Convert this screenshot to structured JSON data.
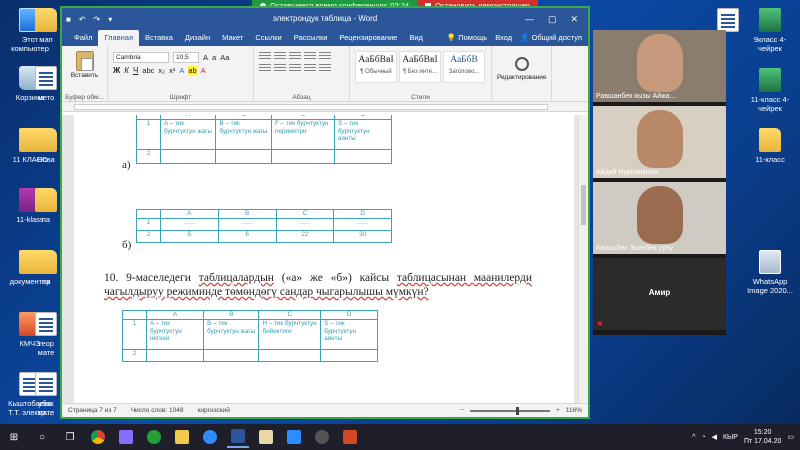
{
  "conference": {
    "time_label": "Оставшееся время конференции: 02:24",
    "stop_label": "Остановить демонстрацию"
  },
  "desktop": {
    "left_icons": [
      "Этот компьютер",
      "Корзина",
      "11 КЛАСС",
      "11-klass",
      "документер",
      "КМЧЭ",
      "Кыштобаева Т.Т. электр..."
    ],
    "left_icons2": [
      "мап",
      "мето",
      "Нова",
      "па",
      "па",
      "теор мате",
      "убак мате"
    ],
    "right_icons": [
      "9класс 4-чейрек",
      "11-класс 4-чейрек",
      "11-класс",
      "WhatsApp Image 2020..."
    ]
  },
  "word": {
    "title": "электрондук таблица - Word",
    "tabs": [
      "Файл",
      "Главная",
      "Вставка",
      "Дизайн",
      "Макет",
      "Ссылки",
      "Рассылки",
      "Рецензирование",
      "Вид"
    ],
    "help": "Помощь",
    "signin": "Вход",
    "share": "Общий доступ",
    "ribbon": {
      "paste": "Вставить",
      "clipboard": "Буфер обм...",
      "font_name": "Cambria",
      "font_size": "10,5",
      "font_group": "Шрифт",
      "para_group": "Абзац",
      "styles_group": "Стили",
      "edit": "Редактирование",
      "styles": [
        {
          "sample": "АаБбВвІ",
          "name": "¶ Обычный"
        },
        {
          "sample": "АаБбВвІ",
          "name": "¶ Без инте..."
        },
        {
          "sample": "АаБбВ",
          "name": "Заголово..."
        }
      ]
    },
    "status": {
      "page": "Страница 7 из 7",
      "words": "Число слов: 1048",
      "lang": "киргизский",
      "zoom": "116%"
    },
    "doc": {
      "table_a": {
        "letter": "а)",
        "headers": [
          "A",
          "B",
          "C",
          "D"
        ],
        "rows": [
          {
            "num": "1",
            "cells": [
              "A – тик бурчтуктун жагы",
              "B – тик бурчтуктун жагы",
              "F – тик бурчтуктун периметри",
              "S – тик бурчтуктун аянты"
            ]
          },
          {
            "num": "2",
            "cells": [
              "",
              "",
              "",
              ""
            ]
          }
        ]
      },
      "table_b": {
        "letter": "б)",
        "headers": [
          "A",
          "B",
          "C",
          "D"
        ],
        "rows": [
          {
            "num": "1",
            "cells": [
              "......",
              "......",
              "......",
              "......"
            ]
          },
          {
            "num": "2",
            "cells": [
              "5",
              "6",
              "22",
              "30"
            ]
          }
        ]
      },
      "task": {
        "number": "10.",
        "text_1": "9-маселедеги",
        "text_2": "таблицалардын",
        "text_3": "(«а» же «б») кайсы",
        "text_4": "таблицасынан маанилерди чагылдыруу режиминде төмөндөгү сандар чыгарылышы мүмкүн?"
      },
      "table_c": {
        "headers": [
          "A",
          "B",
          "C",
          "D"
        ],
        "rows": [
          {
            "num": "1",
            "cells": [
              "A – тик бурчтуктун негизи",
              "B – тик бурчтуктун жагы",
              "H – тик бурчтуктун бийиктиги",
              "S – тик бурчтуктун аянты"
            ]
          },
          {
            "num": "2",
            "cells": [
              "",
              "",
              "",
              ""
            ]
          }
        ]
      }
    }
  },
  "participants": [
    {
      "name": "Равшанбек кызы Айжа...",
      "skin": "#c79a7c",
      "bg": "#8b7d6e"
    },
    {
      "name": "Айдай Нурланкызы",
      "skin": "#b98869",
      "bg": "#d8cfc3"
    },
    {
      "name": "Калысбек Эсенбек уулу",
      "skin": "#9b6b4f",
      "bg": "#cfcac2"
    },
    {
      "name": "Амир"
    }
  ],
  "taskbar": {
    "time": "15:20",
    "date": "Пт 17.04.20",
    "lang": "КЫР"
  }
}
